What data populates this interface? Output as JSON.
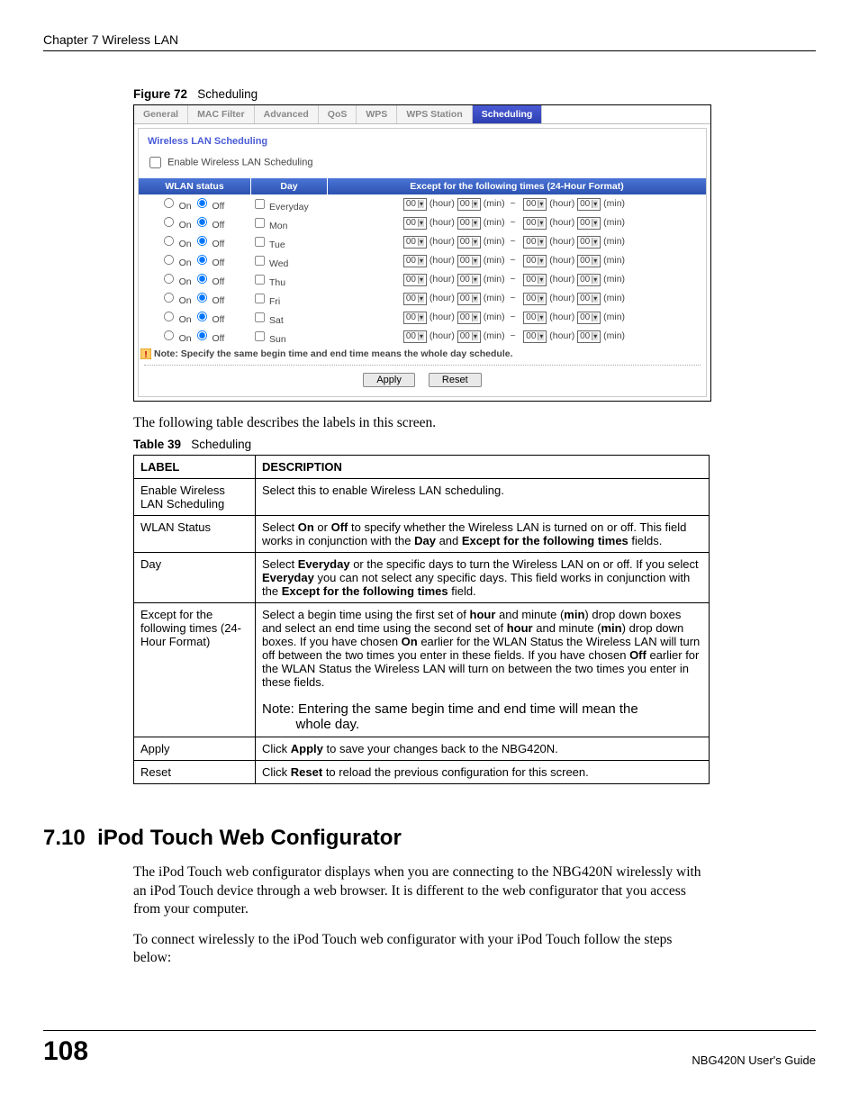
{
  "chapter_header": "Chapter 7 Wireless LAN",
  "figure": {
    "prefix": "Figure 72",
    "title": "Scheduling"
  },
  "tabs": {
    "items": [
      "General",
      "MAC Filter",
      "Advanced",
      "QoS",
      "WPS",
      "WPS Station",
      "Scheduling"
    ],
    "active_index": 6
  },
  "panel": {
    "section_title": "Wireless LAN Scheduling",
    "enable_label": "Enable Wireless LAN Scheduling",
    "headers": {
      "status": "WLAN status",
      "day": "Day",
      "times": "Except for the following times   (24-Hour Format)"
    },
    "on_label": "On",
    "off_label": "Off",
    "hour_label": "(hour)",
    "min_label": "(min)",
    "tilde": "~",
    "default_val": "00",
    "days": [
      "Everyday",
      "Mon",
      "Tue",
      "Wed",
      "Thu",
      "Fri",
      "Sat",
      "Sun"
    ],
    "note": "Note: Specify the same begin time and end time means the whole day schedule.",
    "apply": "Apply",
    "reset": "Reset"
  },
  "intro_text": "The following table describes the labels in this screen.",
  "table_caption": {
    "prefix": "Table 39",
    "title": "Scheduling"
  },
  "table": {
    "head_label": "LABEL",
    "head_desc": "DESCRIPTION",
    "rows": [
      {
        "label": "Enable Wireless LAN Scheduling",
        "desc_html": "Select this to enable Wireless LAN scheduling."
      },
      {
        "label": "WLAN Status",
        "desc_html": "Select <b>On</b> or <b>Off</b> to specify whether the Wireless LAN is turned on or off. This field works in conjunction with the <b>Day</b> and <b>Except for the following times</b> fields."
      },
      {
        "label": "Day",
        "desc_html": "Select <b>Everyday</b> or the specific days to turn the Wireless LAN on or off. If you select <b>Everyday</b> you can not select any specific days. This field works in conjunction with the  <b>Except for the following times</b> field."
      },
      {
        "label": "Except for the following times (24-Hour Format)",
        "desc_html": "Select a begin time using the first set of <b>hour</b> and minute (<b>min</b>) drop down boxes and select an end time using the second set of <b>hour</b> and minute (<b>min</b>) drop down boxes. If you have chosen <b>On</b> earlier for the WLAN Status the Wireless LAN will turn off between the two times you enter in these fields. If you have chosen <b>Off</b> earlier for the WLAN Status the Wireless LAN will turn on between the two times you enter in these fields.<span class='notecell'>Note: Entering the same begin time and end time will mean the<br>&nbsp;&nbsp;&nbsp;&nbsp;&nbsp;&nbsp;&nbsp;&nbsp;&nbsp;whole day.</span>"
      },
      {
        "label": "Apply",
        "desc_html": "Click <b>Apply</b> to save your changes back to the NBG420N."
      },
      {
        "label": "Reset",
        "desc_html": "Click <b>Reset</b> to reload the previous configuration for this screen."
      }
    ]
  },
  "section": {
    "number": "7.10",
    "title": "iPod Touch Web Configurator",
    "para1": "The iPod Touch web configurator displays when you are connecting to the NBG420N wirelessly with an iPod Touch device through a web browser. It is different to the web configurator that you access from your computer.",
    "para2": "To connect wirelessly to the iPod Touch web configurator with your iPod Touch follow the steps below:"
  },
  "footer": {
    "page": "108",
    "guide": "NBG420N User's Guide"
  }
}
